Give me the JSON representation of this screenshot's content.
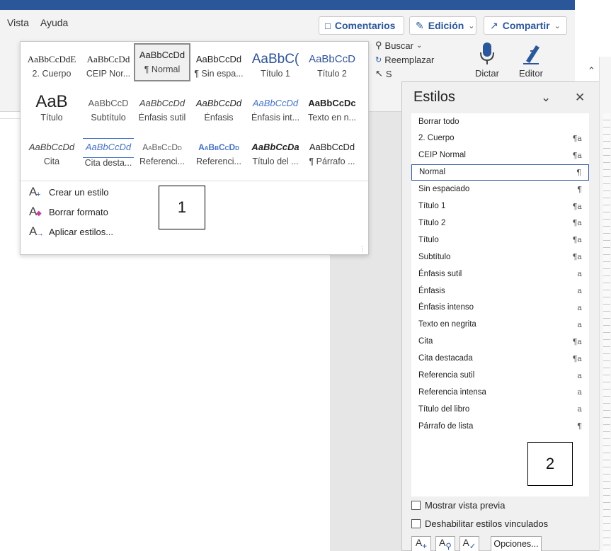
{
  "menu": {
    "tabs": [
      "Vista",
      "Ayuda"
    ]
  },
  "topbar": {
    "comments_label": "Comentarios",
    "editing_label": "Edición",
    "share_label": "Compartir"
  },
  "ribbon": {
    "find_label": "Buscar",
    "replace_label": "Reemplazar",
    "select_label": "S",
    "dictate_label": "Dictar",
    "editor_label": "Editor"
  },
  "gallery": {
    "styles": [
      {
        "preview": "AaBbCcDdE",
        "caption": "2. Cuerpo"
      },
      {
        "preview": "AaBbCcDd",
        "caption": "CEIP Nor..."
      },
      {
        "preview": "AaBbCcDd",
        "caption": "¶ Normal"
      },
      {
        "preview": "AaBbCcDd",
        "caption": "¶ Sin espa..."
      },
      {
        "preview": "AaBbC(",
        "caption": "Título 1"
      },
      {
        "preview": "AaBbCcD",
        "caption": "Título 2"
      },
      {
        "preview": "AaB",
        "caption": "Título"
      },
      {
        "preview": "AaBbCcD",
        "caption": "Subtítulo"
      },
      {
        "preview": "AaBbCcDd",
        "caption": "Énfasis sutil"
      },
      {
        "preview": "AaBbCcDd",
        "caption": "Énfasis"
      },
      {
        "preview": "AaBbCcDd",
        "caption": "Énfasis int..."
      },
      {
        "preview": "AaBbCcDc",
        "caption": "Texto en n..."
      },
      {
        "preview": "AaBbCcDd",
        "caption": "Cita"
      },
      {
        "preview": "AaBbCcDd",
        "caption": "Cita desta..."
      },
      {
        "preview": "AaBbCcDd",
        "caption": "Referenci..."
      },
      {
        "preview": "AaBbCcDd",
        "caption": "Referenci..."
      },
      {
        "preview": "AaBbCcDa",
        "caption": "Título del ..."
      },
      {
        "preview": "AaBbCcDd",
        "caption": "¶ Párrafo ..."
      }
    ],
    "commands": [
      "Crear un estilo",
      "Borrar formato",
      "Aplicar estilos..."
    ]
  },
  "annotations": {
    "box1": "1",
    "box2": "2"
  },
  "pane": {
    "title": "Estilos",
    "items": [
      {
        "label": "Borrar todo",
        "mark": ""
      },
      {
        "label": "2. Cuerpo",
        "mark": "¶a"
      },
      {
        "label": "CEIP Normal",
        "mark": "¶a"
      },
      {
        "label": "Normal",
        "mark": "¶"
      },
      {
        "label": "Sin espaciado",
        "mark": "¶"
      },
      {
        "label": "Título 1",
        "mark": "¶a"
      },
      {
        "label": "Título 2",
        "mark": "¶a"
      },
      {
        "label": "Título",
        "mark": "¶a"
      },
      {
        "label": "Subtítulo",
        "mark": "¶a"
      },
      {
        "label": "Énfasis sutil",
        "mark": "a"
      },
      {
        "label": "Énfasis",
        "mark": "a"
      },
      {
        "label": "Énfasis intenso",
        "mark": "a"
      },
      {
        "label": "Texto en negrita",
        "mark": "a"
      },
      {
        "label": "Cita",
        "mark": "¶a"
      },
      {
        "label": "Cita destacada",
        "mark": "¶a"
      },
      {
        "label": "Referencia sutil",
        "mark": "a"
      },
      {
        "label": "Referencia intensa",
        "mark": "a"
      },
      {
        "label": "Título del libro",
        "mark": "a"
      },
      {
        "label": "Párrafo de lista",
        "mark": "¶"
      }
    ],
    "show_preview_label": "Mostrar vista previa",
    "disable_linked_label": "Deshabilitar estilos vinculados",
    "options_label": "Opciones..."
  },
  "colors": {
    "accent": "#2b579a",
    "selected_border": "#2b579a"
  }
}
